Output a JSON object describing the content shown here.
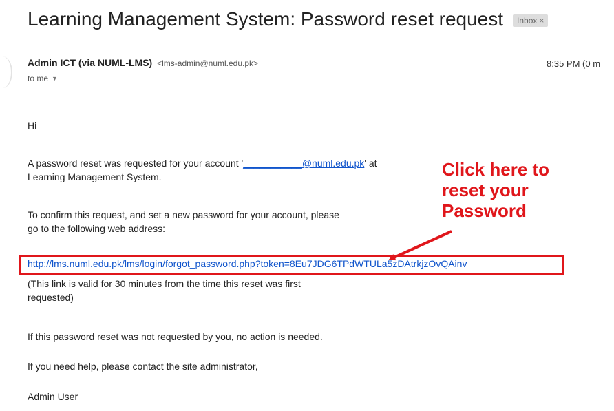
{
  "email": {
    "subject": "Learning Management System: Password reset request",
    "label": "Inbox",
    "label_close": "×",
    "sender_name": "Admin ICT (via NUML-LMS)",
    "sender_email": "<lms-admin@numl.edu.pk>",
    "time": "8:35 PM (0 m",
    "recipient": "to me",
    "caret": "▼"
  },
  "body": {
    "greeting": "Hi",
    "para1_pre": "A password reset was requested for your account '",
    "account_link": "___________@numl.edu.pk",
    "para1_post": "' at",
    "para1_line2": "Learning Management System.",
    "para2_line1": "To confirm this request, and set a new password for your account, please",
    "para2_line2": "go to the following web address:",
    "reset_url": "http://lms.numl.edu.pk/lms/login/forgot_password.php?token=8Eu7JDG6TPdWTULa5zDAtrkjzOvQAinv",
    "validity_line1": "(This link is valid for 30 minutes from the time this reset was first",
    "validity_line2": "requested)",
    "para4": "If this password reset was not requested by you, no action is needed.",
    "para5": "If you need help, please contact the site administrator,",
    "signature": "Admin User"
  },
  "annotation": {
    "line1": "Click here to",
    "line2": "reset your",
    "line3": "Password",
    "color": "#e0161b"
  }
}
